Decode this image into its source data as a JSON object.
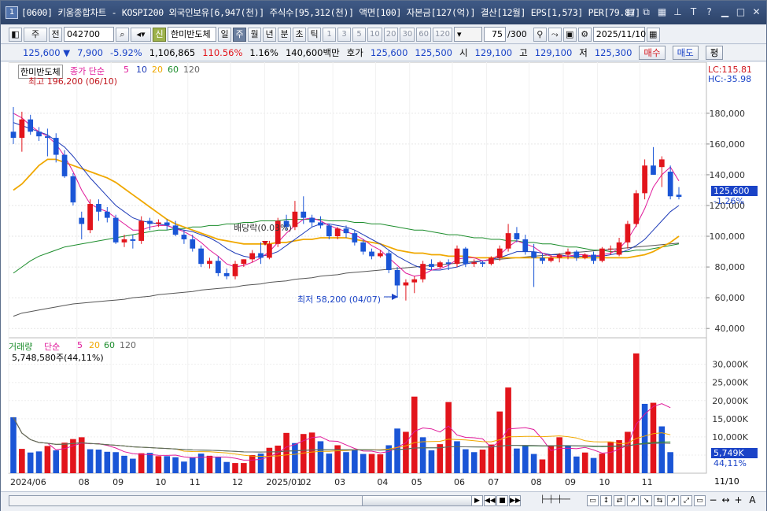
{
  "window": {
    "number": "1",
    "title": "[0600] 키움종합차트 - KOSPI200 외국인보유[6,947(천)] 주식수[95,312(천)] 액면[100] 자본금[127(억)] 결산[12월] EPS[1,573] PER[79.87]"
  },
  "toolbar": {
    "period": "주",
    "prev": "전",
    "code": "042700",
    "sin_label": "신",
    "stock_name": "한미반도체",
    "tabs": [
      "일",
      "주",
      "월",
      "년",
      "분",
      "초",
      "틱"
    ],
    "active_tab": "주",
    "intervals": [
      "1",
      "3",
      "5",
      "10",
      "20",
      "30",
      "60",
      "120"
    ],
    "count": "75",
    "total": "/300",
    "date": "2025/11/10"
  },
  "quote": {
    "price": "125,600 ▼",
    "change": "7,900",
    "change_pct": "-5.92%",
    "volume": "1,106,865",
    "vol_ratio": "110.56%",
    "turnover_pct": "1.16%",
    "amount": "140,600백만",
    "bid_label": "호가",
    "ask": "125,600",
    "bid": "125,500",
    "open_label": "시",
    "open": "129,100",
    "high_label": "고",
    "high": "129,100",
    "low_label": "저",
    "low": "125,300",
    "buy": "매수",
    "sell": "매도",
    "avg": "평"
  },
  "price_panel": {
    "name": "한미반도체",
    "legend_label": "종가 단순",
    "ma_periods": [
      "5",
      "10",
      "20",
      "60",
      "120"
    ],
    "ma_colors": [
      "#e0199a",
      "#1f3cb8",
      "#f0a800",
      "#1c8d2c",
      "#555555"
    ],
    "max_label": "최고 196,200 (06/10)",
    "min_label": "최저 58,200 (04/07)",
    "dividend_label": "배당락(0.03%)",
    "lc": "LC:115.81",
    "hc": "HC:-35.98",
    "current_price": "125,600",
    "current_pct": "-1.26%",
    "y_ticks": [
      "180,000",
      "160,000",
      "140,000",
      "120,000",
      "100,000",
      "80,000",
      "60,000",
      "40,000"
    ]
  },
  "volume_panel": {
    "legend_label": "거래량",
    "sma_label": "단순",
    "ma_periods": [
      "5",
      "20",
      "60",
      "120"
    ],
    "info": "5,748,580주(44,11%)",
    "current": "5,749K",
    "current_pct": "44,11%",
    "y_ticks": [
      "30,000K",
      "25,000K",
      "20,000K",
      "15,000K",
      "10,000K",
      "5,000K"
    ]
  },
  "x_axis": {
    "labels": [
      "2024/06",
      "08",
      "09",
      "10",
      "11",
      "12",
      "2025/01",
      "02",
      "03",
      "04",
      "05",
      "06",
      "07",
      "08",
      "09",
      "10",
      "11"
    ],
    "right_label": "11/10"
  },
  "chart_data": {
    "type": "candlestick",
    "y_range": [
      36000,
      204000
    ],
    "ohlc": [
      [
        168000,
        184000,
        160000,
        164000
      ],
      [
        164000,
        181000,
        155000,
        176000
      ],
      [
        176000,
        179000,
        166000,
        168000
      ],
      [
        168000,
        171000,
        162000,
        165000
      ],
      [
        165000,
        170000,
        152000,
        164000
      ],
      [
        164000,
        167000,
        148000,
        153000
      ],
      [
        153000,
        156000,
        138000,
        139000
      ],
      [
        139000,
        141000,
        120000,
        122000
      ],
      [
        112000,
        116000,
        98000,
        108000
      ],
      [
        104000,
        124000,
        102000,
        121000
      ],
      [
        121000,
        124000,
        110000,
        116000
      ],
      [
        116000,
        119000,
        109000,
        112000
      ],
      [
        112000,
        114000,
        95000,
        96000
      ],
      [
        96000,
        101000,
        93000,
        98000
      ],
      [
        98000,
        101000,
        92000,
        97000
      ],
      [
        97000,
        113000,
        95000,
        110000
      ],
      [
        110000,
        112000,
        104000,
        108000
      ],
      [
        108000,
        111000,
        106000,
        109000
      ],
      [
        109000,
        111000,
        104000,
        107000
      ],
      [
        107000,
        110000,
        100000,
        101000
      ],
      [
        101000,
        104000,
        95000,
        98000
      ],
      [
        98000,
        101000,
        90000,
        92000
      ],
      [
        92000,
        94000,
        80000,
        82000
      ],
      [
        82000,
        86000,
        79000,
        84000
      ],
      [
        84000,
        87000,
        74000,
        76000
      ],
      [
        76000,
        79000,
        72000,
        74000
      ],
      [
        74000,
        84000,
        72000,
        82000
      ],
      [
        82000,
        85000,
        80000,
        85000
      ],
      [
        85000,
        91000,
        83000,
        89000
      ],
      [
        89000,
        96000,
        82000,
        86000
      ],
      [
        86000,
        97000,
        85000,
        95000
      ],
      [
        95000,
        112000,
        93000,
        110000
      ],
      [
        110000,
        114000,
        104000,
        106000
      ],
      [
        106000,
        123000,
        104000,
        116000
      ],
      [
        116000,
        126000,
        108000,
        112000
      ],
      [
        112000,
        114000,
        106000,
        109000
      ],
      [
        109000,
        113000,
        105000,
        107000
      ],
      [
        107000,
        108000,
        98000,
        100000
      ],
      [
        100000,
        106000,
        98000,
        105000
      ],
      [
        105000,
        107000,
        99000,
        102000
      ],
      [
        102000,
        104000,
        94000,
        96000
      ],
      [
        96000,
        98000,
        88000,
        90000
      ],
      [
        90000,
        92000,
        85000,
        87000
      ],
      [
        87000,
        91000,
        86000,
        89000
      ],
      [
        89000,
        91000,
        76000,
        78000
      ],
      [
        78000,
        80000,
        60000,
        68000
      ],
      [
        68000,
        72000,
        58200,
        70000
      ],
      [
        70000,
        74000,
        63000,
        72000
      ],
      [
        72000,
        84000,
        70000,
        82000
      ],
      [
        82000,
        85000,
        78000,
        80000
      ],
      [
        80000,
        84000,
        79000,
        83000
      ],
      [
        83000,
        85000,
        78000,
        82000
      ],
      [
        82000,
        94000,
        80000,
        92000
      ],
      [
        92000,
        93000,
        80000,
        82000
      ],
      [
        82000,
        85000,
        80000,
        83000
      ],
      [
        83000,
        84000,
        80000,
        82000
      ],
      [
        82000,
        87000,
        81000,
        86000
      ],
      [
        86000,
        94000,
        84000,
        92000
      ],
      [
        92000,
        108000,
        90000,
        102000
      ],
      [
        102000,
        106000,
        96000,
        98000
      ],
      [
        98000,
        101000,
        88000,
        90000
      ],
      [
        90000,
        95000,
        67000,
        86000
      ],
      [
        86000,
        89000,
        82000,
        84000
      ],
      [
        84000,
        88000,
        83000,
        86000
      ],
      [
        86000,
        89000,
        83000,
        88000
      ],
      [
        88000,
        92000,
        85000,
        90000
      ],
      [
        90000,
        91000,
        84000,
        86000
      ],
      [
        86000,
        89000,
        85000,
        88000
      ],
      [
        88000,
        90000,
        82000,
        84000
      ],
      [
        84000,
        93000,
        83000,
        92000
      ],
      [
        92000,
        94000,
        88000,
        92000
      ],
      [
        88000,
        99000,
        87000,
        96000
      ],
      [
        96000,
        110000,
        92000,
        108000
      ],
      [
        108000,
        130000,
        106000,
        128000
      ],
      [
        128000,
        150000,
        124000,
        146000
      ],
      [
        146000,
        158000,
        140000,
        140000
      ],
      [
        145000,
        152000,
        132000,
        150000
      ],
      [
        142000,
        146000,
        124000,
        126000
      ],
      [
        127000,
        132000,
        124000,
        125600
      ]
    ],
    "ma5": [
      180000,
      177000,
      172000,
      168000,
      165000,
      160000,
      152000,
      142000,
      130000,
      121000,
      118000,
      116000,
      112000,
      108000,
      104000,
      104000,
      106000,
      107000,
      107000,
      105000,
      103000,
      100000,
      96000,
      91000,
      87000,
      82000,
      80000,
      81000,
      83000,
      86000,
      90000,
      96000,
      102000,
      107000,
      111000,
      112000,
      110000,
      107000,
      105000,
      103000,
      101000,
      98000,
      94000,
      91000,
      86000,
      81000,
      76000,
      74000,
      75000,
      78000,
      79000,
      81000,
      85000,
      86000,
      86000,
      84000,
      85000,
      88000,
      93000,
      97000,
      95000,
      93000,
      89000,
      87000,
      87000,
      87000,
      88000,
      88000,
      87000,
      88000,
      89000,
      92000,
      98000,
      107000,
      118000,
      132000,
      140000,
      145000,
      136000
    ],
    "ma10": [
      174000,
      172000,
      170000,
      168000,
      166000,
      162000,
      158000,
      152000,
      145000,
      138000,
      132000,
      126000,
      120000,
      116000,
      112000,
      110000,
      109000,
      108000,
      107000,
      105000,
      104000,
      103000,
      101000,
      99000,
      96000,
      92000,
      89000,
      87000,
      86000,
      87000,
      88000,
      90000,
      94000,
      98000,
      102000,
      106000,
      108000,
      108000,
      107000,
      106000,
      104000,
      101000,
      98000,
      95000,
      91000,
      87000,
      84000,
      81000,
      79000,
      78000,
      78000,
      79000,
      80000,
      82000,
      83000,
      84000,
      85000,
      86000,
      88000,
      90000,
      90000,
      90000,
      89000,
      88000,
      88000,
      87000,
      87000,
      87000,
      87000,
      87000,
      88000,
      89000,
      91000,
      94000,
      98000,
      104000,
      110000,
      116000,
      120000
    ],
    "ma20": [
      130000,
      134000,
      140000,
      146000,
      150000,
      150000,
      148000,
      146000,
      144000,
      142000,
      140000,
      138000,
      135000,
      131000,
      127000,
      123000,
      119000,
      115000,
      111000,
      108000,
      106000,
      104000,
      102000,
      100000,
      98000,
      97000,
      96000,
      95000,
      95000,
      95000,
      95000,
      96000,
      96000,
      97000,
      98000,
      98000,
      99000,
      99000,
      99000,
      99000,
      98000,
      97000,
      96000,
      95000,
      93000,
      91000,
      90000,
      89000,
      89000,
      88000,
      88000,
      87000,
      87000,
      87000,
      86000,
      86000,
      86000,
      86000,
      86000,
      86000,
      86000,
      86000,
      86000,
      86000,
      86000,
      86000,
      86000,
      86000,
      86000,
      86000,
      86000,
      86000,
      86000,
      87000,
      88000,
      90000,
      93000,
      96000,
      100000
    ],
    "ma60": [
      76000,
      80000,
      84000,
      87000,
      89000,
      91000,
      93000,
      94000,
      95000,
      96000,
      97000,
      98000,
      99000,
      100000,
      101000,
      102000,
      103000,
      104000,
      104000,
      105000,
      105000,
      106000,
      106000,
      107000,
      107000,
      108000,
      108000,
      109000,
      109000,
      110000,
      110000,
      110000,
      111000,
      111000,
      111000,
      111000,
      111000,
      110000,
      110000,
      110000,
      109000,
      109000,
      108000,
      108000,
      107000,
      106000,
      105000,
      104000,
      104000,
      103000,
      102000,
      101000,
      101000,
      100000,
      99000,
      99000,
      98000,
      98000,
      97000,
      97000,
      96000,
      96000,
      95000,
      95000,
      94000,
      93000,
      93000,
      92000,
      91000,
      91000,
      90000,
      90000,
      90000,
      91000,
      91000,
      92000,
      93000,
      94000,
      95000
    ],
    "ma120": [
      48000,
      50000,
      51000,
      52000,
      53000,
      54000,
      55000,
      56000,
      56500,
      57000,
      57500,
      58000,
      58500,
      59000,
      60000,
      60500,
      61000,
      62000,
      62500,
      63000,
      63500,
      64000,
      65000,
      65500,
      66000,
      66500,
      67000,
      68000,
      68500,
      69000,
      70000,
      70500,
      71000,
      72000,
      72500,
      73000,
      74000,
      74500,
      75000,
      76000,
      76500,
      77000,
      77500,
      78000,
      78500,
      79000,
      79500,
      80000,
      80500,
      81000,
      81500,
      82000,
      82500,
      83000,
      83500,
      84000,
      84500,
      85000,
      85500,
      86000,
      86500,
      87000,
      87500,
      88000,
      88500,
      89000,
      89500,
      90000,
      90500,
      91000,
      91500,
      92000,
      92500,
      93000,
      93500,
      94000,
      94500,
      95000,
      95500
    ],
    "volume_k": [
      15400,
      6700,
      5700,
      6000,
      7500,
      6300,
      8400,
      9400,
      9900,
      6600,
      6500,
      5900,
      5800,
      4800,
      4000,
      5500,
      5600,
      4700,
      4700,
      4400,
      3200,
      4400,
      5400,
      4800,
      4500,
      3100,
      2800,
      2800,
      5000,
      5400,
      7000,
      7600,
      11100,
      8300,
      10800,
      11200,
      8800,
      5400,
      7700,
      5800,
      6300,
      5300,
      5300,
      5200,
      7700,
      12300,
      11400,
      21100,
      9900,
      6300,
      8000,
      19600,
      8800,
      6600,
      5800,
      6500,
      7900,
      17000,
      23600,
      6800,
      7500,
      5300,
      3800,
      7700,
      9900,
      7700,
      4600,
      5700,
      4200,
      5400,
      8700,
      9100,
      11400,
      33000,
      19100,
      19400,
      12900,
      5800
    ],
    "volume_colors": [
      "b",
      "r",
      "b",
      "b",
      "r",
      "b",
      "r",
      "r",
      "r",
      "b",
      "b",
      "b",
      "b",
      "b",
      "b",
      "r",
      "b",
      "r",
      "b",
      "b",
      "b",
      "b",
      "b",
      "r",
      "b",
      "b",
      "r",
      "r",
      "r",
      "b",
      "r",
      "r",
      "r",
      "b",
      "r",
      "r",
      "b",
      "b",
      "r",
      "b",
      "b",
      "b",
      "r",
      "r",
      "b",
      "b",
      "r",
      "r",
      "b",
      "b",
      "r",
      "r",
      "b",
      "b",
      "b",
      "r",
      "r",
      "r",
      "r",
      "b",
      "b",
      "b",
      "r",
      "r",
      "r",
      "b",
      "b",
      "r",
      "b",
      "r",
      "r",
      "r",
      "r",
      "r",
      "b",
      "r",
      "b",
      "b"
    ]
  }
}
